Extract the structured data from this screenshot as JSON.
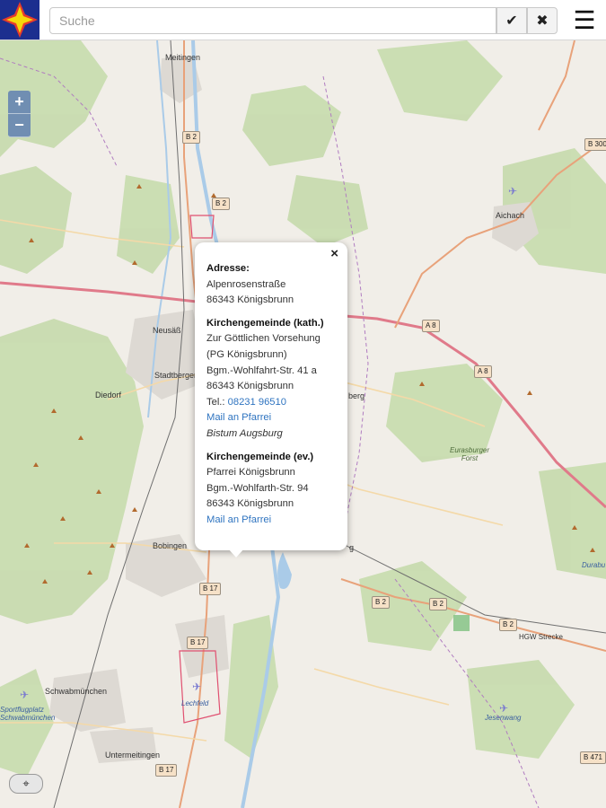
{
  "header": {
    "search_placeholder": "Suche",
    "search_value": "",
    "confirm_icon": "checkmark-icon",
    "clear_icon": "close-icon",
    "menu_icon": "hamburger-menu-icon",
    "logo_icon": "compass-star-logo-icon"
  },
  "zoom": {
    "in_label": "+",
    "out_label": "−"
  },
  "map": {
    "place_labels": [
      "Meitingen",
      "Aichach",
      "Neusäß",
      "Stadtbergen",
      "Diedorf",
      "Bobingen",
      "Schwabmünchen",
      "Untermeitingen",
      "berg",
      "g",
      "Lechfeld",
      "Sportflugplatz",
      "Schwabmünchen",
      "Eurasburger Forst",
      "Jesenwang",
      "HGW Strecke",
      "Durabu"
    ],
    "road_shields": [
      "B 2",
      "B 2",
      "B 300",
      "A 8",
      "A 8",
      "B 17",
      "B 17",
      "B 17",
      "B 2",
      "B 2",
      "B 2",
      "B 471"
    ]
  },
  "popup": {
    "close_label": "×",
    "address_heading": "Adresse:",
    "address_street": "Alpenrosenstraße",
    "address_city": "86343 Königsbrunn",
    "kath_heading": "Kirchengemeinde (kath.)",
    "kath_name": "Zur Göttlichen Vorsehung",
    "kath_pg": "(PG Königsbrunn)",
    "kath_street": "Bgm.-Wohlfahrt-Str. 41 a",
    "kath_city": "86343 Königsbrunn",
    "kath_tel_label": "Tel.:",
    "kath_tel": "08231 96510",
    "kath_mail": "Mail an Pfarrei",
    "kath_diocese": "Bistum Augsburg",
    "ev_heading": "Kirchengemeinde (ev.)",
    "ev_name": "Pfarrei Königsbrunn",
    "ev_street": "Bgm.-Wohlfarth-Str. 94",
    "ev_city": "86343 Königsbrunn",
    "ev_mail": "Mail an Pfarrei"
  },
  "colors": {
    "topbar_bg": "#ffffff",
    "map_bg": "#f1eee8",
    "forest": "#c8dcb0",
    "water": "#aacbe8",
    "motorway": "#e07a8a",
    "link": "#2f74c0"
  }
}
